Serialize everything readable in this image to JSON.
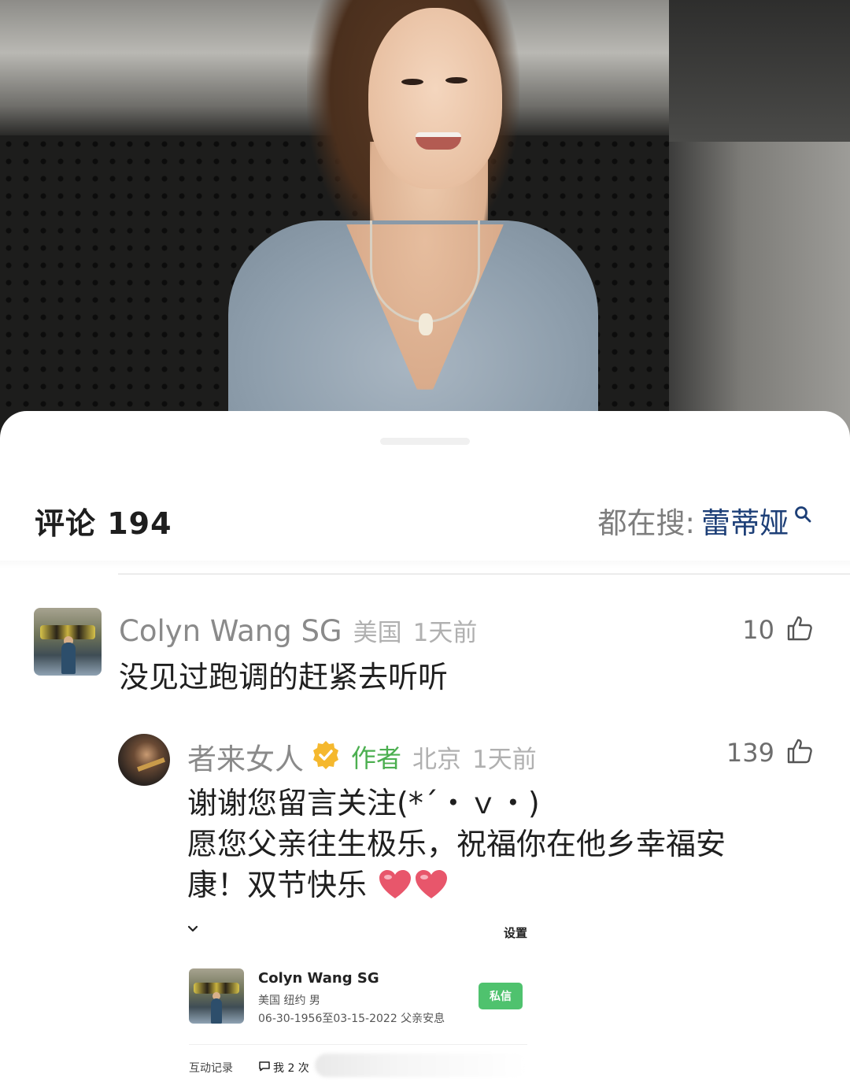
{
  "comments_header": {
    "title": "评论 194",
    "trending_label": "都在搜:",
    "trending_term": "蕾蒂娅"
  },
  "comments": [
    {
      "name": "Colyn Wang SG",
      "location": "美国",
      "time": "1天前",
      "likes": "10",
      "text": "没见过跑调的赶紧去听听"
    },
    {
      "name": "者来女人",
      "author_tag": "作者",
      "location": "北京",
      "time": "1天前",
      "likes": "139",
      "text_line1": "谢谢您留言关注(*´・ｖ・)",
      "text_line2": "愿您父亲往生极乐，祝福你在他乡幸福安",
      "text_line3": "康！双节快乐"
    }
  ],
  "embedded_profile": {
    "settings_label": "设置",
    "name": "Colyn Wang SG",
    "location_gender": "美国 纽约  男",
    "bio": "06-30-1956至03-15-2022 父亲安息",
    "dm_button": "私信",
    "history_label": "互动记录",
    "mention_count": "我 2 次"
  },
  "colors": {
    "trending_term": "#1d3f77",
    "author_tag": "#4caf50",
    "dm_button": "#4fc26e",
    "verified_badge": "#f5b82e"
  },
  "icons": [
    "search-icon",
    "thumbs-up-icon",
    "verified-badge-icon",
    "heart-emoji",
    "chevron-down-icon",
    "chat-icon"
  ]
}
